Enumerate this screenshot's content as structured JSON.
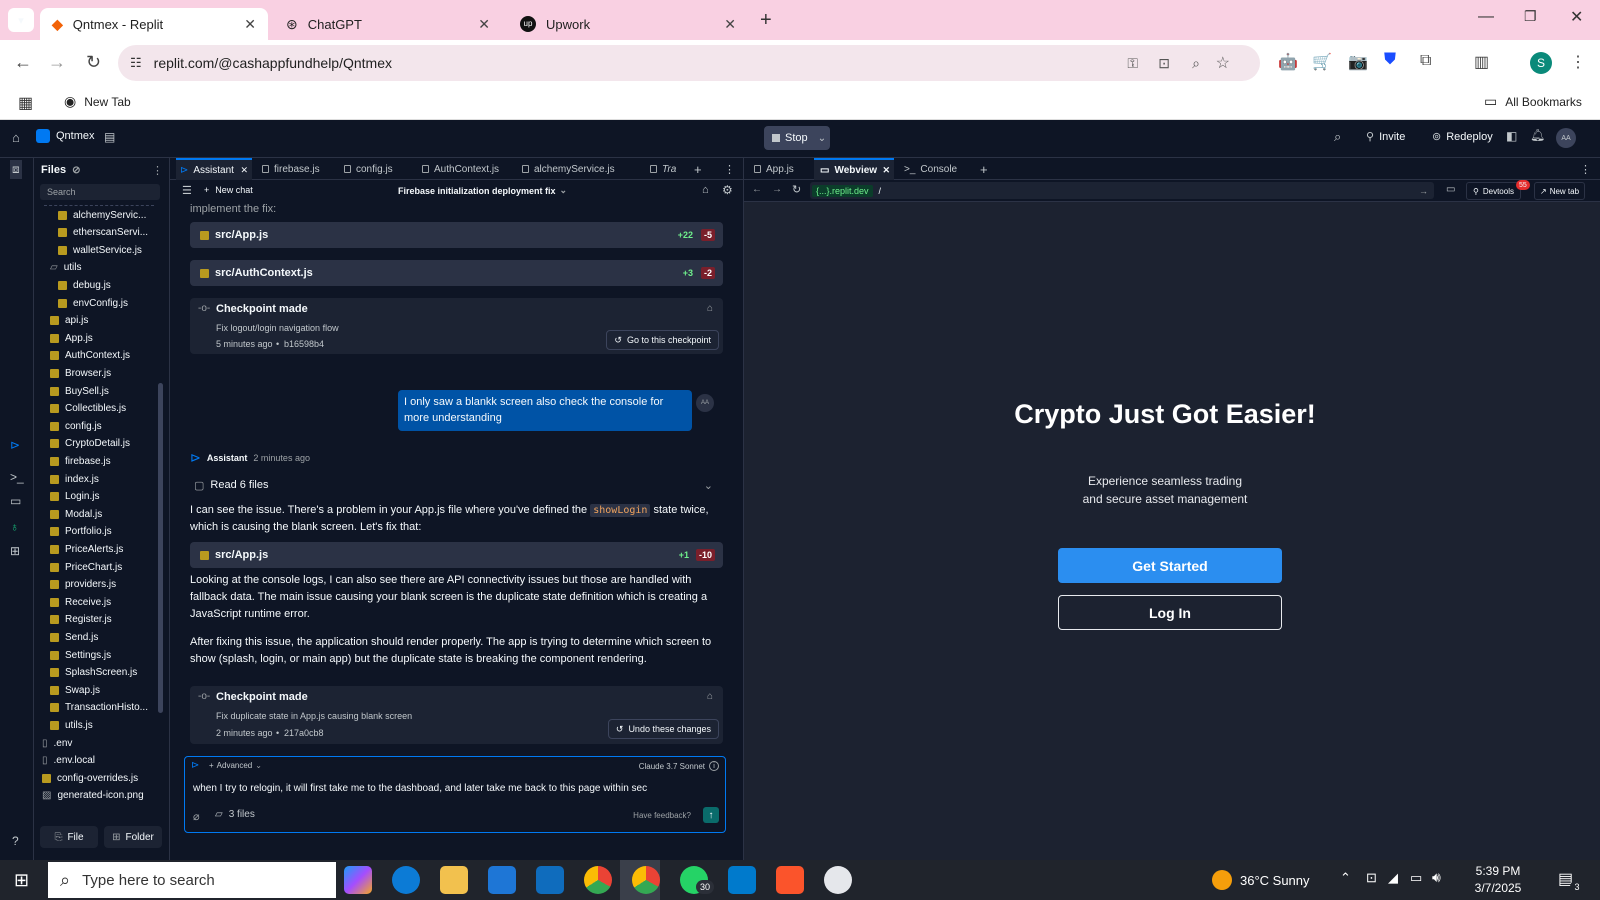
{
  "browser": {
    "tabs": [
      {
        "label": "Qntmex - Replit",
        "active": true
      },
      {
        "label": "ChatGPT",
        "active": false
      },
      {
        "label": "Upwork",
        "active": false
      }
    ],
    "url": "replit.com/@cashappfundhelp/Qntmex",
    "bookmarks": {
      "new_tab": "New Tab",
      "all_bookmarks": "All Bookmarks"
    },
    "profile_initial": "S"
  },
  "replit": {
    "project": "Qntmex",
    "stop_label": "Stop",
    "invite_label": "Invite",
    "redeploy_label": "Redeploy",
    "avatar": "AA"
  },
  "files": {
    "title": "Files",
    "search_placeholder": "Search",
    "items": [
      {
        "name": "alchemyServic...",
        "type": "js",
        "indent": 2
      },
      {
        "name": "etherscanServi...",
        "type": "js",
        "indent": 2
      },
      {
        "name": "walletService.js",
        "type": "js",
        "indent": 2
      },
      {
        "name": "utils",
        "type": "folder",
        "indent": 1
      },
      {
        "name": "debug.js",
        "type": "js",
        "indent": 2
      },
      {
        "name": "envConfig.js",
        "type": "js",
        "indent": 2
      },
      {
        "name": "api.js",
        "type": "js",
        "indent": 1
      },
      {
        "name": "App.js",
        "type": "js",
        "indent": 1
      },
      {
        "name": "AuthContext.js",
        "type": "js",
        "indent": 1
      },
      {
        "name": "Browser.js",
        "type": "js",
        "indent": 1
      },
      {
        "name": "BuySell.js",
        "type": "js",
        "indent": 1
      },
      {
        "name": "Collectibles.js",
        "type": "js",
        "indent": 1
      },
      {
        "name": "config.js",
        "type": "js",
        "indent": 1
      },
      {
        "name": "CryptoDetail.js",
        "type": "js",
        "indent": 1
      },
      {
        "name": "firebase.js",
        "type": "js",
        "indent": 1
      },
      {
        "name": "index.js",
        "type": "js",
        "indent": 1
      },
      {
        "name": "Login.js",
        "type": "js",
        "indent": 1
      },
      {
        "name": "Modal.js",
        "type": "js",
        "indent": 1
      },
      {
        "name": "Portfolio.js",
        "type": "js",
        "indent": 1
      },
      {
        "name": "PriceAlerts.js",
        "type": "js",
        "indent": 1
      },
      {
        "name": "PriceChart.js",
        "type": "js",
        "indent": 1
      },
      {
        "name": "providers.js",
        "type": "js",
        "indent": 1
      },
      {
        "name": "Receive.js",
        "type": "js",
        "indent": 1
      },
      {
        "name": "Register.js",
        "type": "js",
        "indent": 1
      },
      {
        "name": "Send.js",
        "type": "js",
        "indent": 1
      },
      {
        "name": "Settings.js",
        "type": "js",
        "indent": 1
      },
      {
        "name": "SplashScreen.js",
        "type": "js",
        "indent": 1
      },
      {
        "name": "Swap.js",
        "type": "js",
        "indent": 1
      },
      {
        "name": "TransactionHisto...",
        "type": "js",
        "indent": 1
      },
      {
        "name": "utils.js",
        "type": "js",
        "indent": 1
      },
      {
        "name": ".env",
        "type": "file",
        "indent": 0
      },
      {
        "name": ".env.local",
        "type": "file",
        "indent": 0
      },
      {
        "name": "config-overrides.js",
        "type": "js",
        "indent": 0
      },
      {
        "name": "generated-icon.png",
        "type": "img",
        "indent": 0
      }
    ],
    "file_btn": "File",
    "folder_btn": "Folder"
  },
  "editor_tabs": [
    "Assistant",
    "firebase.js",
    "config.js",
    "AuthContext.js",
    "alchemyService.js",
    "Tra"
  ],
  "assistant": {
    "new_chat": "New chat",
    "chat_title": "Firebase initialization deployment fix",
    "cut_text": "implement the fix:",
    "diff1": {
      "file": "src/App.js",
      "add": "+22",
      "del": "-5"
    },
    "diff2": {
      "file": "src/AuthContext.js",
      "add": "+3",
      "del": "-2"
    },
    "checkpoint1": {
      "title": "Checkpoint made",
      "desc": "Fix logout/login navigation flow",
      "time": "5 minutes ago",
      "hash": "b16598b4",
      "btn": "Go to this checkpoint"
    },
    "user_msg": "I only saw a blankk screen also check the console for more understanding",
    "user_avatar": "AA",
    "assistant_name": "Assistant",
    "assistant_time": "2 minutes ago",
    "read_files": "Read 6 files",
    "para1_a": "I can see the issue. There's a problem in your App.js file where you've defined the",
    "para1_code": "showLogin",
    "para1_b": "state twice, which is causing the blank screen. Let's fix that:",
    "diff3": {
      "file": "src/App.js",
      "add": "+1",
      "del": "-10"
    },
    "para2": "Looking at the console logs, I can also see there are API connectivity issues but those are handled with fallback data. The main issue causing your blank screen is the duplicate state definition which is creating a JavaScript runtime error.",
    "para3": "After fixing this issue, the application should render properly. The app is trying to determine which screen to show (splash, login, or main app) but the duplicate state is breaking the component rendering.",
    "checkpoint2": {
      "title": "Checkpoint made",
      "desc": "Fix duplicate state in App.js causing blank screen",
      "time": "2 minutes ago",
      "hash": "217a0cb8",
      "btn": "Undo these changes"
    },
    "input_advanced": "Advanced",
    "model": "Claude 3.7 Sonnet",
    "input_value": "when I try to relogin, it will first take me to the dashboad, and later take me back to this page within sec",
    "files_attached": "3 files",
    "feedback": "Have feedback?"
  },
  "webview": {
    "tabs": [
      "App.js",
      "Webview",
      "Console"
    ],
    "domain": "{...}.replit.dev",
    "path": "/",
    "devtools": "Devtools",
    "devtools_badge": "55",
    "new_tab": "New tab",
    "hero_title": "Crypto Just Got Easier!",
    "hero_sub1": "Experience seamless trading",
    "hero_sub2": "and secure asset management",
    "get_started": "Get Started",
    "login": "Log In"
  },
  "taskbar": {
    "search_placeholder": "Type here to search",
    "weather": "36°C Sunny",
    "time": "5:39 PM",
    "date": "3/7/2025",
    "whatsapp_badge": "30",
    "notif_count": "3"
  }
}
